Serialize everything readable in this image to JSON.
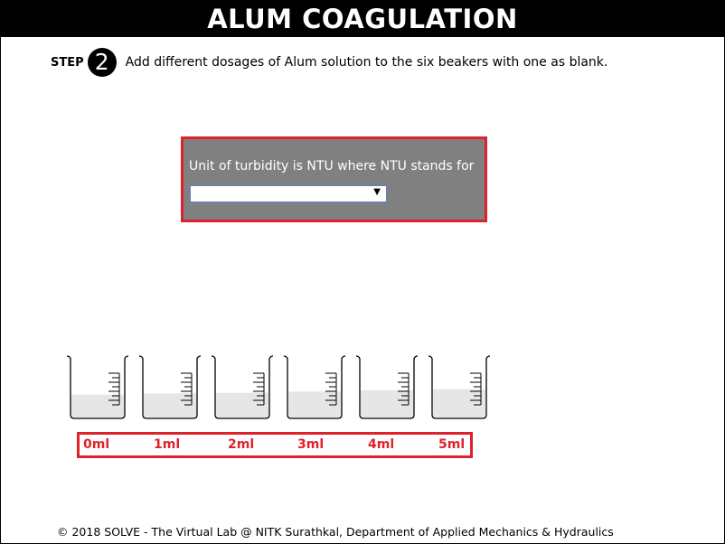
{
  "header": {
    "title": "ALUM COAGULATION"
  },
  "step": {
    "label": "STEP",
    "number": "2",
    "instruction": "Add different dosages of Alum solution to the six beakers with one as blank."
  },
  "question": {
    "text": "Unit of turbidity is NTU where NTU stands for",
    "select_value": "",
    "arrow": "▼"
  },
  "beakers": [
    {
      "label": "0ml",
      "fill_fraction": 0.4
    },
    {
      "label": "1ml",
      "fill_fraction": 0.42
    },
    {
      "label": "2ml",
      "fill_fraction": 0.43
    },
    {
      "label": "3ml",
      "fill_fraction": 0.45
    },
    {
      "label": "4ml",
      "fill_fraction": 0.47
    },
    {
      "label": "5ml",
      "fill_fraction": 0.49
    }
  ],
  "colors": {
    "accent_red": "#e0202a",
    "panel_gray": "#808080",
    "liquid": "#e6e6e6"
  },
  "footer": {
    "text": "© 2018 SOLVE - The Virtual Lab @ NITK Surathkal, Department of Applied Mechanics & Hydraulics"
  }
}
